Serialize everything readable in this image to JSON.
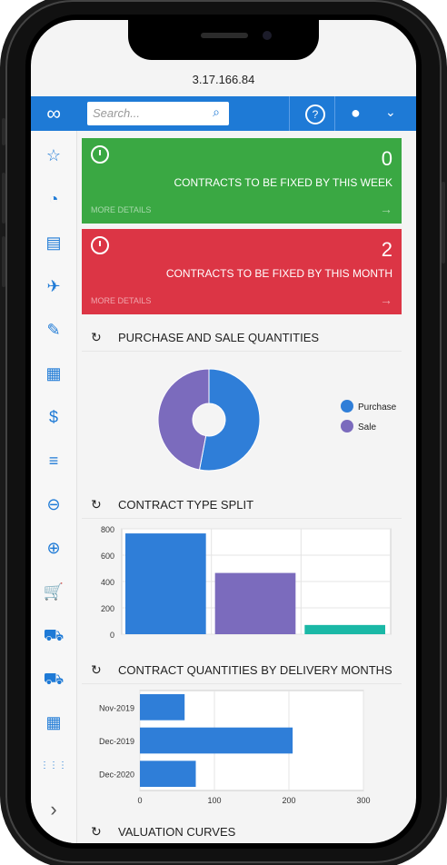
{
  "browser": {
    "url": "3.17.166.84"
  },
  "topbar": {
    "search_placeholder": "Search...",
    "help_label": "?",
    "user_icon": "user-icon",
    "caret_icon": "chevron-down-icon",
    "color": "#1e7ad6"
  },
  "sidebar": {
    "items": [
      {
        "icon": "star-icon",
        "glyph": "☆"
      },
      {
        "icon": "pie-chart-icon",
        "glyph": "◔"
      },
      {
        "icon": "contract-icon",
        "glyph": "▤"
      },
      {
        "icon": "plane-icon",
        "glyph": "✈"
      },
      {
        "icon": "edit-icon",
        "glyph": "✎"
      },
      {
        "icon": "calculator-icon",
        "glyph": "▦"
      },
      {
        "icon": "dollar-icon",
        "glyph": "$"
      },
      {
        "icon": "bars-icon",
        "glyph": "≡"
      },
      {
        "icon": "minus-circle-icon",
        "glyph": "⊖"
      },
      {
        "icon": "plus-circle-icon",
        "glyph": "⊕"
      },
      {
        "icon": "cart-icon",
        "glyph": "🛒"
      },
      {
        "icon": "truck-icon",
        "glyph": "⛟"
      },
      {
        "icon": "truck-icon-2",
        "glyph": "⛟"
      },
      {
        "icon": "calculator-icon-2",
        "glyph": "▦"
      },
      {
        "icon": "grid-icon",
        "glyph": "⋮⋮⋮"
      },
      {
        "icon": "chevron-right-icon",
        "glyph": "›"
      }
    ]
  },
  "cards": [
    {
      "count": "0",
      "label": "CONTRACTS TO BE FIXED BY THIS WEEK",
      "more": "MORE DETAILS",
      "color": "#3aa843"
    },
    {
      "count": "2",
      "label": "CONTRACTS TO BE FIXED BY THIS MONTH",
      "more": "MORE DETAILS",
      "color": "#dc3545"
    }
  ],
  "sections": {
    "purchase_sale": "PURCHASE AND SALE QUANTITIES",
    "contract_type": "CONTRACT TYPE SPLIT",
    "delivery_months": "CONTRACT QUANTITIES BY DELIVERY MONTHS",
    "valuation": "VALUATION CURVES"
  },
  "chart_data": [
    {
      "type": "pie",
      "title": "PURCHASE AND SALE QUANTITIES",
      "categories": [
        "Purchase",
        "Sale"
      ],
      "values": [
        53,
        47
      ],
      "colors": [
        "#2f7ed8",
        "#7b6bbd"
      ],
      "donut": true,
      "legend": "right"
    },
    {
      "type": "bar",
      "title": "CONTRACT TYPE SPLIT",
      "categories": [
        "",
        "",
        ""
      ],
      "values": [
        765,
        465,
        70
      ],
      "colors": [
        "#2f7ed8",
        "#7b6bbd",
        "#1ab8a6"
      ],
      "ylim": [
        0,
        800
      ],
      "yticks": [
        0,
        200,
        400,
        600,
        800
      ],
      "grid": true
    },
    {
      "type": "bar",
      "orientation": "horizontal",
      "title": "CONTRACT QUANTITIES BY DELIVERY MONTHS",
      "categories": [
        "Nov-2019",
        "Dec-2019",
        "Dec-2020"
      ],
      "values": [
        60,
        205,
        75
      ],
      "colors": [
        "#2f7ed8"
      ],
      "xlim": [
        0,
        300
      ],
      "xticks": [
        0,
        100,
        200,
        300
      ],
      "grid": true
    }
  ]
}
